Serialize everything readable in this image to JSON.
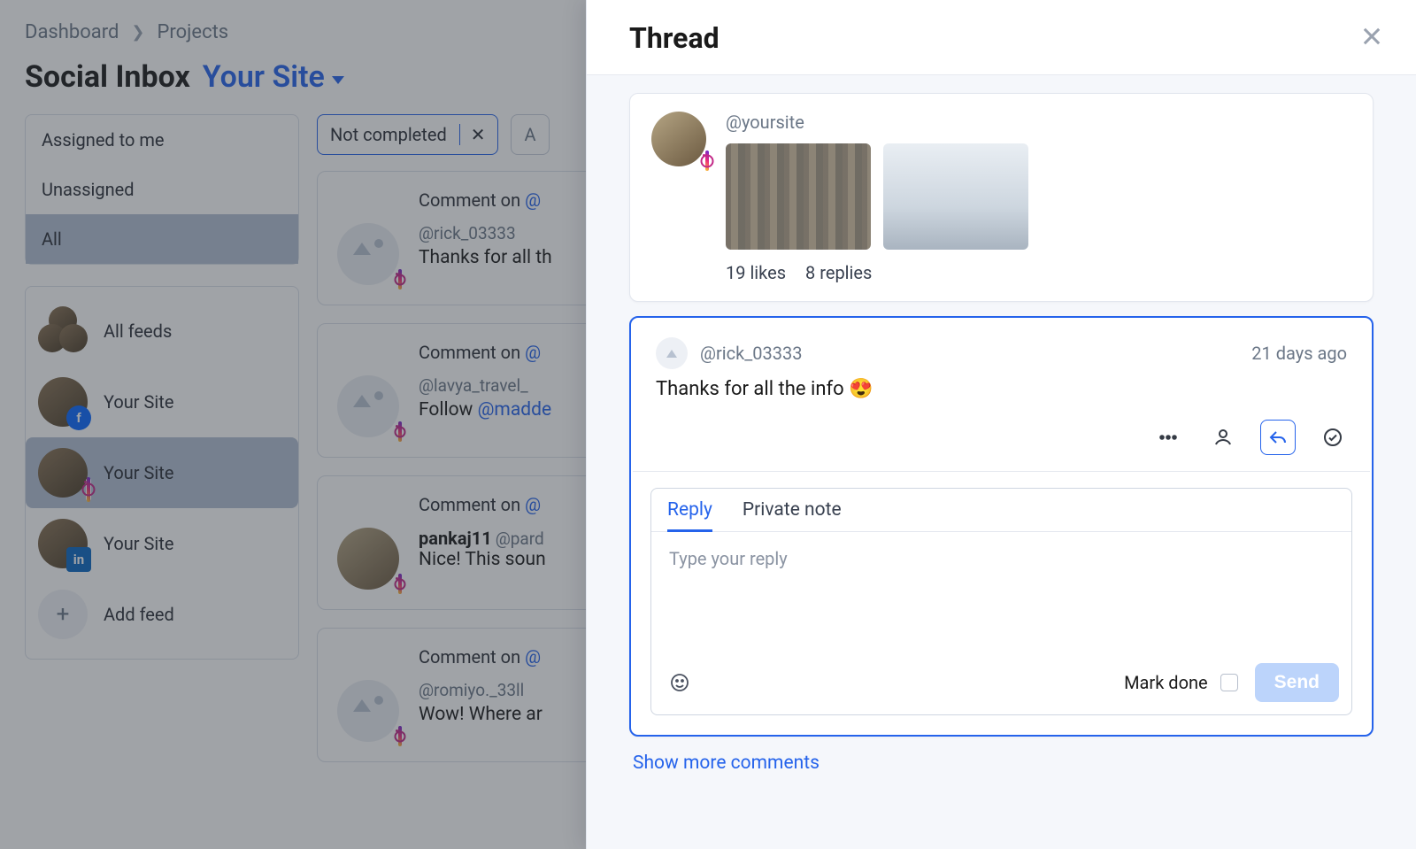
{
  "breadcrumbs": {
    "dashboard": "Dashboard",
    "projects": "Projects"
  },
  "page": {
    "title": "Social Inbox",
    "site": "Your Site"
  },
  "assign": {
    "me": "Assigned to me",
    "unassigned": "Unassigned",
    "all": "All"
  },
  "feeds": {
    "all": "All feeds",
    "items": [
      {
        "label": "Your Site",
        "platform": "facebook"
      },
      {
        "label": "Your Site",
        "platform": "instagram"
      },
      {
        "label": "Your Site",
        "platform": "linkedin"
      }
    ],
    "add": "Add feed"
  },
  "filters": {
    "chip1": "Not completed",
    "chip2": "A"
  },
  "inbox": [
    {
      "heading_prefix": "Comment on ",
      "heading_link": "@",
      "handle": "@rick_03333",
      "text": "Thanks for all th"
    },
    {
      "heading_prefix": "Comment on ",
      "heading_link": "@",
      "handle": "@lavya_travel_",
      "text_pre": "Follow ",
      "text_link": "@madde"
    },
    {
      "heading_prefix": "Comment on ",
      "heading_link": "@",
      "name": "pankaj11",
      "grey_handle": "@pard",
      "text": "Nice! This soun"
    },
    {
      "heading_prefix": "Comment on ",
      "heading_link": "@",
      "handle": "@romiyo._33ll",
      "text": "Wow! Where ar"
    }
  ],
  "thread": {
    "title": "Thread",
    "post": {
      "handle": "@yoursite",
      "likes": "19 likes",
      "replies": "8 replies"
    },
    "selected": {
      "handle": "@rick_03333",
      "time": "21 days ago",
      "text": "Thanks for all the info 😍"
    },
    "reply": {
      "tab_reply": "Reply",
      "tab_note": "Private note",
      "placeholder": "Type your reply",
      "mark_done": "Mark done",
      "send": "Send"
    },
    "show_more": "Show more comments"
  }
}
